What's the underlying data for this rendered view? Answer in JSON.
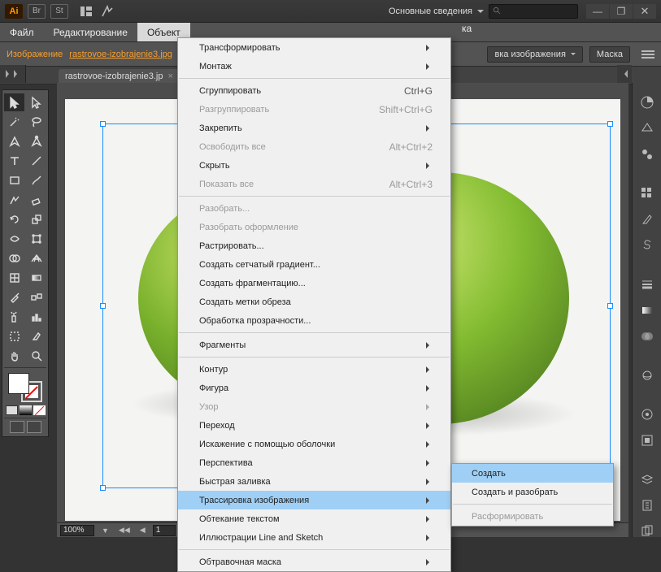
{
  "titlebar": {
    "logo": "Ai",
    "br": "Br",
    "st": "St",
    "workspace": "Основные сведения"
  },
  "win": {
    "min": "—",
    "max": "❐",
    "close": "✕"
  },
  "menubar": {
    "file": "Файл",
    "edit": "Редактирование",
    "object": "Объект",
    "suffix": "ка"
  },
  "control": {
    "label": "Изображение",
    "file": "rastrovoe-izobrajenie3.jpg",
    "trace_drop": "вка изображения",
    "mask_btn": "Маска"
  },
  "doc_tab": {
    "name": "rastrovoe-izobrajenie3.jp",
    "close": "×"
  },
  "status": {
    "zoom": "100%",
    "page": "1"
  },
  "menu": {
    "transform": "Трансформировать",
    "arrange": "Монтаж",
    "group": "Сгруппировать",
    "group_sc": "Ctrl+G",
    "ungroup": "Разгруппировать",
    "ungroup_sc": "Shift+Ctrl+G",
    "lock": "Закрепить",
    "unlock": "Освободить все",
    "unlock_sc": "Alt+Ctrl+2",
    "hide": "Скрыть",
    "showall": "Показать все",
    "showall_sc": "Alt+Ctrl+3",
    "expand": "Разобрать...",
    "expand_app": "Разобрать оформление",
    "rasterize": "Растрировать...",
    "mesh": "Создать сетчатый градиент...",
    "fragment": "Создать фрагментацию...",
    "crops": "Создать метки обреза",
    "flatten": "Обработка прозрачности...",
    "fragments": "Фрагменты",
    "path": "Контур",
    "shape": "Фигура",
    "pattern": "Узор",
    "blend": "Переход",
    "envelope": "Искажение с помощью оболочки",
    "perspective": "Перспектива",
    "livepaint": "Быстрая заливка",
    "trace": "Трассировка изображения",
    "wrap": "Обтекание текстом",
    "lineandsketch": "Иллюстрации Line and Sketch",
    "clipmask": "Обтравочная маска"
  },
  "submenu": {
    "create": "Создать",
    "create_expand": "Создать и разобрать",
    "release": "Расформировать"
  }
}
